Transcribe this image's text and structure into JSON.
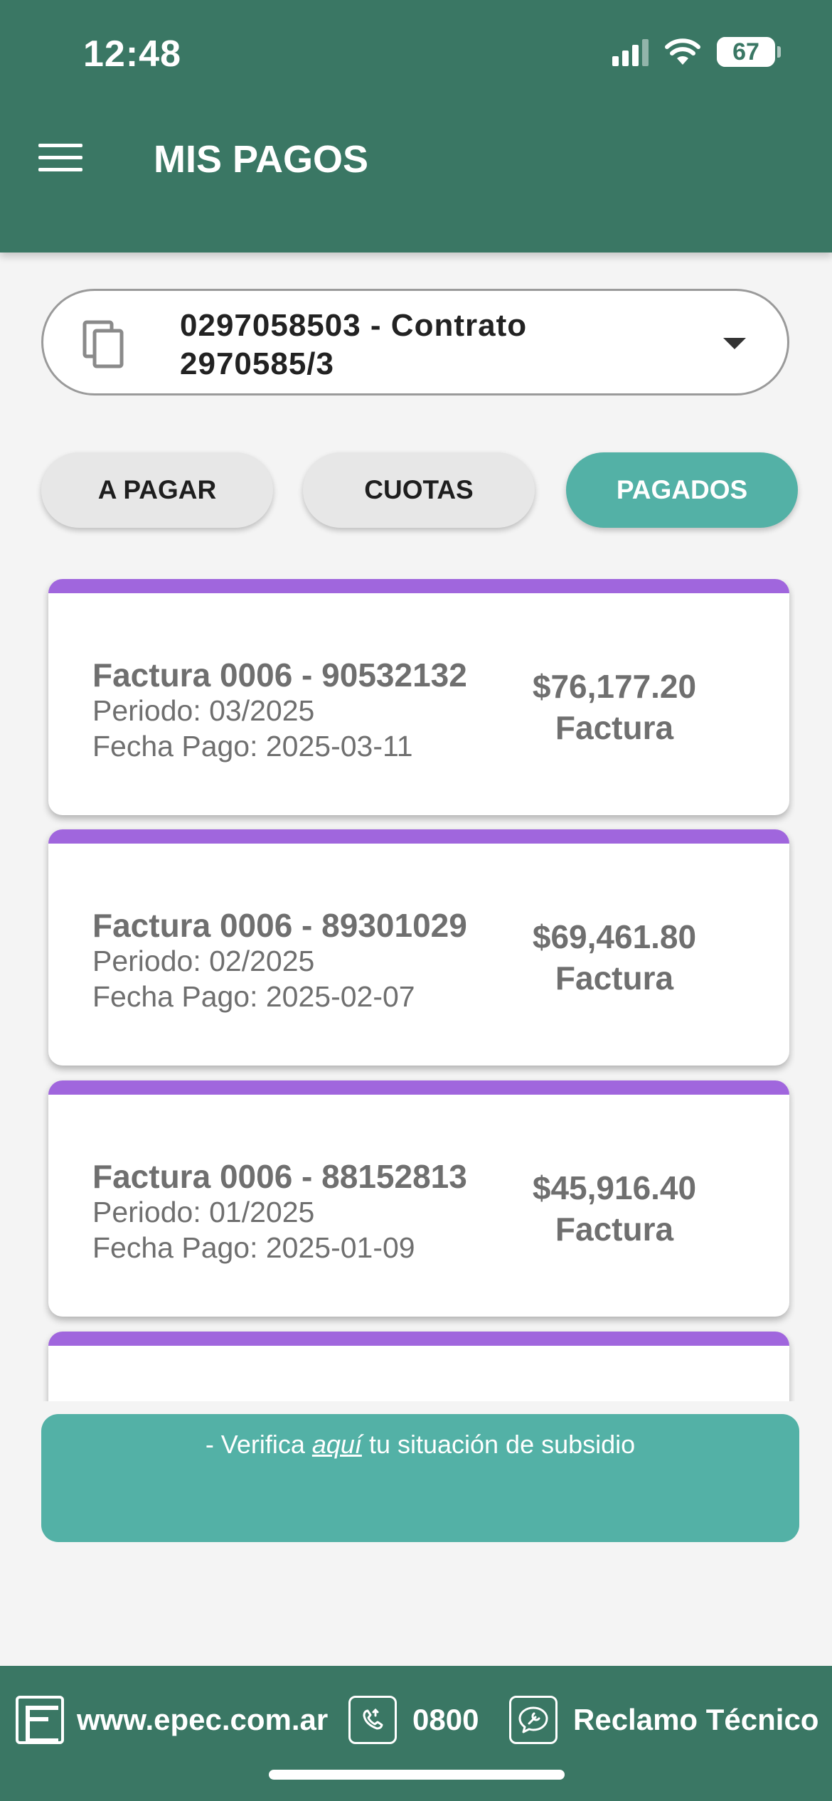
{
  "status_bar": {
    "time": "12:48",
    "battery": "67",
    "battery_level": 0.67
  },
  "header": {
    "title": "MIS PAGOS",
    "menu_icon": "hamburger-menu-icon"
  },
  "contract_selector": {
    "line1": "0297058503 - Contrato",
    "line2": "2970585/3",
    "icon": "copy-icon",
    "dropdown_icon": "caret-down-icon"
  },
  "tabs": [
    {
      "label": "A PAGAR",
      "active": false
    },
    {
      "label": "CUOTAS",
      "active": false
    },
    {
      "label": "PAGADOS",
      "active": true
    }
  ],
  "payments": [
    {
      "title": "Factura 0006 - 90532132",
      "period": "Periodo: 03/2025",
      "paid_date": "Fecha Pago: 2025-03-11",
      "amount": "$76,177.20",
      "type": "Factura"
    },
    {
      "title": "Factura 0006 - 89301029",
      "period": "Periodo: 02/2025",
      "paid_date": "Fecha Pago: 2025-02-07",
      "amount": "$69,461.80",
      "type": "Factura"
    },
    {
      "title": "Factura 0006 - 88152813",
      "period": "Periodo: 01/2025",
      "paid_date": "Fecha Pago: 2025-01-09",
      "amount": "$45,916.40",
      "type": "Factura"
    }
  ],
  "subsidy_banner": {
    "prefix": "- Verifica ",
    "link": "aquí",
    "suffix": " tu situación de subsidio"
  },
  "footer": {
    "website": "www.epec.com.ar",
    "phone": "0800",
    "claim": "Reclamo Técnico"
  },
  "colors": {
    "primary": "#3a7764",
    "accent": "#53b1a6",
    "card_bar": "#a066dd"
  }
}
